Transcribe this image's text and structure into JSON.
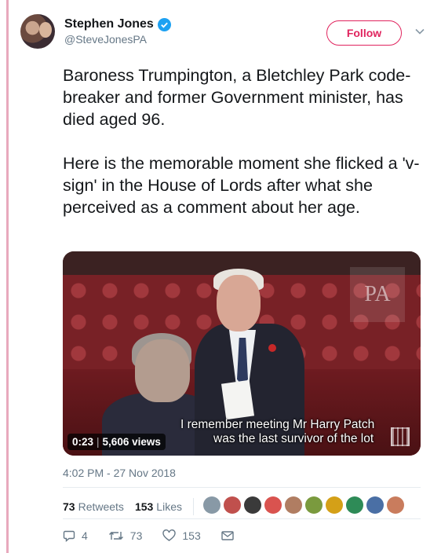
{
  "user": {
    "display_name": "Stephen Jones",
    "handle": "@SteveJonesPA",
    "verified": true
  },
  "follow_button": {
    "label": "Follow",
    "color": "#e0245e"
  },
  "tweet": {
    "paragraph1": "Baroness Trumpington, a Bletchley Park code-breaker and former Government minister, has died aged 96.",
    "paragraph2": "Here is the memorable moment she flicked a 'v-sign' in the House of Lords after what she perceived as a comment about her age."
  },
  "media": {
    "watermark": "PA",
    "subtitle_line1": "I remember meeting Mr Harry Patch",
    "subtitle_line2": "was the last survivor of the lot",
    "duration": "0:23",
    "views": "5,606 views"
  },
  "timestamp": "4:02 PM - 27 Nov 2018",
  "engagement": {
    "retweets_count": "73",
    "retweets_label": "Retweets",
    "likes_count": "153",
    "likes_label": "Likes",
    "liker_avatars": [
      "#8899a6",
      "#c0504d",
      "#3a3a3a",
      "#d9534f",
      "#b07d62",
      "#7a9a3e",
      "#d4a017",
      "#2e8b57",
      "#4a6fa5",
      "#c97c5d"
    ]
  },
  "actions": {
    "replies": "4",
    "retweets": "73",
    "likes": "153"
  },
  "colors": {
    "accent_verified": "#1da1f2",
    "thread_line": "#e8a9bd",
    "secondary_text": "#657786"
  }
}
